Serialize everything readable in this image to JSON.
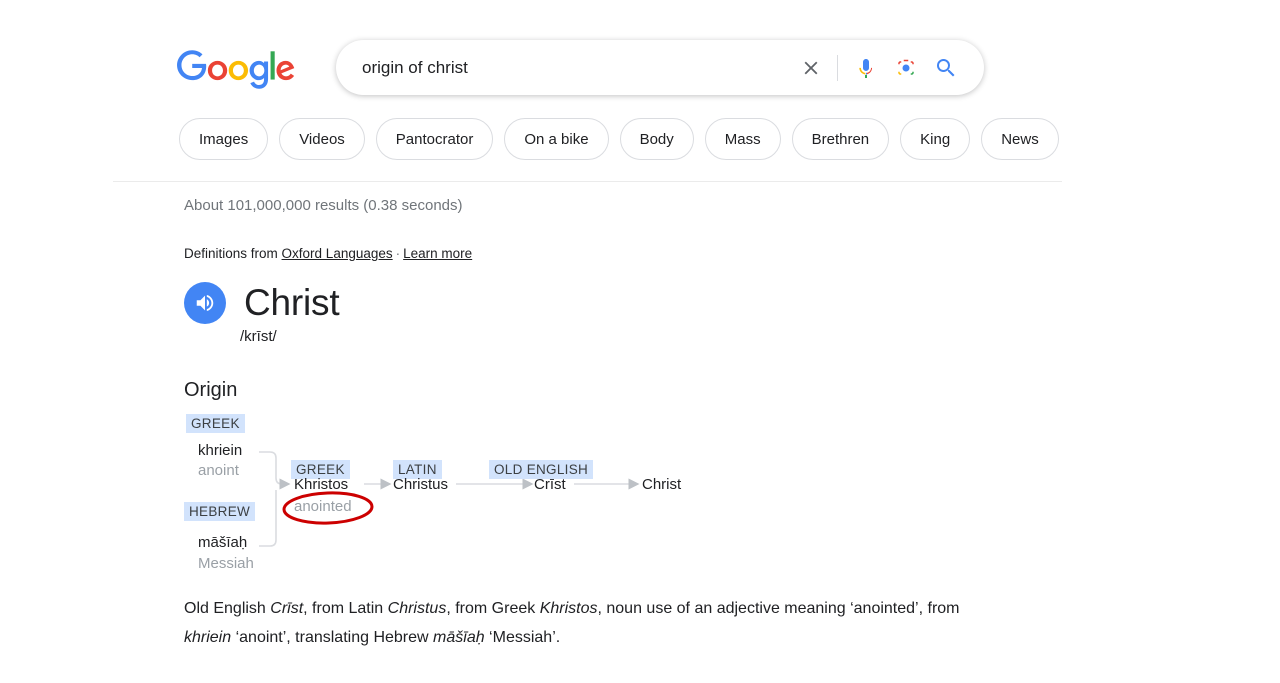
{
  "header": {
    "logo_name": "google-logo",
    "search": {
      "value": "origin of christ",
      "placeholder": "Search",
      "clear_label": "Clear",
      "mic_label": "Search by voice",
      "lens_label": "Search by image",
      "submit_label": "Google Search"
    },
    "chips": [
      {
        "label": "Images"
      },
      {
        "label": "Videos"
      },
      {
        "label": "Pantocrator"
      },
      {
        "label": "On a bike"
      },
      {
        "label": "Body"
      },
      {
        "label": "Mass"
      },
      {
        "label": "Brethren"
      },
      {
        "label": "King"
      },
      {
        "label": "News"
      }
    ]
  },
  "results": {
    "stats": "About 101,000,000 results (0.38 seconds)",
    "definitions_prefix": "Definitions from ",
    "definitions_source": "Oxford Languages",
    "definitions_separator": "·",
    "learn_more": "Learn more"
  },
  "dictionary": {
    "headword": "Christ",
    "phonetic": "/krīst/",
    "speaker_icon": "speaker-icon",
    "origin_heading": "Origin",
    "paragraph": {
      "part1": "Old English ",
      "italic1": "Crīst",
      "part2": ", from Latin ",
      "italic2": "Christus",
      "part3": ", from Greek ",
      "italic3": "Khristos",
      "part4": ", noun use of an adjective meaning ‘anointed’, from ",
      "italic4": "khriein",
      "part5": " ‘anoint’, translating Hebrew ",
      "italic5": "māšīaḥ",
      "part6": " ‘Messiah’."
    }
  },
  "etymology_tree": {
    "nodes": [
      {
        "tag": "GREEK",
        "word": "khriein",
        "gloss": "anoint"
      },
      {
        "tag": "HEBREW",
        "word": "māšīaḥ",
        "gloss": "Messiah"
      },
      {
        "tag": "GREEK",
        "word": "Khristos",
        "gloss": "anointed"
      },
      {
        "tag": "LATIN",
        "word": "Christus",
        "gloss": ""
      },
      {
        "tag": "OLD ENGLISH",
        "word": "Crīst",
        "gloss": ""
      },
      {
        "tag": "",
        "word": "Christ",
        "gloss": ""
      }
    ],
    "annotation": {
      "type": "red-ellipse",
      "target": "anointed",
      "color": "#cc0000"
    }
  },
  "colors": {
    "blue": "#4285f4",
    "tag_bg": "#d2e3fc",
    "gloss_gray": "#9aa0a6",
    "arrow_gray": "#bdc1c6",
    "annotation_red": "#cc0000"
  }
}
